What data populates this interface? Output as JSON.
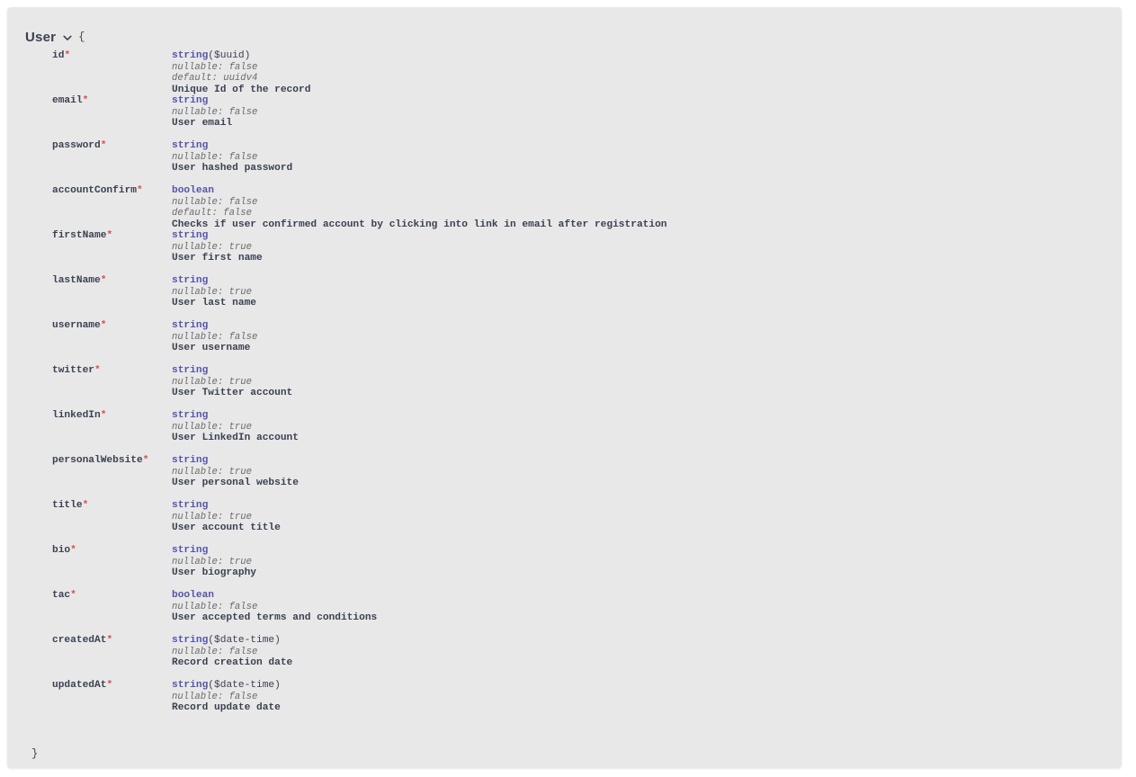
{
  "panel": {
    "background_color": "#e8e8e8",
    "page_background_color": "#ffffff"
  },
  "model": {
    "name": "User",
    "toggle_icon": "chevron-down-icon",
    "brace_open": "{",
    "brace_close": "}",
    "expanded": true
  },
  "colors": {
    "type": "#5555aa",
    "required_marker": "#d9534f",
    "text": "#3b4151",
    "meta": "#6b6b6b"
  },
  "required_marker": "*",
  "properties": [
    {
      "name": "id",
      "required": true,
      "type": "string",
      "format": "($uuid)",
      "meta": [
        "nullable: false",
        "default: uuidv4"
      ],
      "description": "Unique Id of the record"
    },
    {
      "name": "email",
      "required": true,
      "type": "string",
      "format": "",
      "meta": [
        "nullable: false"
      ],
      "description": "User email"
    },
    {
      "name": "password",
      "required": true,
      "type": "string",
      "format": "",
      "meta": [
        "nullable: false"
      ],
      "description": "User hashed password"
    },
    {
      "name": "accountConfirm",
      "required": true,
      "type": "boolean",
      "format": "",
      "meta": [
        "nullable: false",
        "default: false"
      ],
      "description": "Checks if user confirmed account by clicking into link in email after registration"
    },
    {
      "name": "firstName",
      "required": true,
      "type": "string",
      "format": "",
      "meta": [
        "nullable: true"
      ],
      "description": "User first name"
    },
    {
      "name": "lastName",
      "required": true,
      "type": "string",
      "format": "",
      "meta": [
        "nullable: true"
      ],
      "description": "User last name"
    },
    {
      "name": "username",
      "required": true,
      "type": "string",
      "format": "",
      "meta": [
        "nullable: false"
      ],
      "description": "User username"
    },
    {
      "name": "twitter",
      "required": true,
      "type": "string",
      "format": "",
      "meta": [
        "nullable: true"
      ],
      "description": "User Twitter account"
    },
    {
      "name": "linkedIn",
      "required": true,
      "type": "string",
      "format": "",
      "meta": [
        "nullable: true"
      ],
      "description": "User LinkedIn account"
    },
    {
      "name": "personalWebsite",
      "required": true,
      "type": "string",
      "format": "",
      "meta": [
        "nullable: true"
      ],
      "description": "User personal website"
    },
    {
      "name": "title",
      "required": true,
      "type": "string",
      "format": "",
      "meta": [
        "nullable: true"
      ],
      "description": "User account title"
    },
    {
      "name": "bio",
      "required": true,
      "type": "string",
      "format": "",
      "meta": [
        "nullable: true"
      ],
      "description": "User biography"
    },
    {
      "name": "tac",
      "required": true,
      "type": "boolean",
      "format": "",
      "meta": [
        "nullable: false"
      ],
      "description": "User accepted terms and conditions"
    },
    {
      "name": "createdAt",
      "required": true,
      "type": "string",
      "format": "($date-time)",
      "meta": [
        "nullable: false"
      ],
      "description": "Record creation date"
    },
    {
      "name": "updatedAt",
      "required": true,
      "type": "string",
      "format": "($date-time)",
      "meta": [
        "nullable: false"
      ],
      "description": "Record update date"
    }
  ]
}
